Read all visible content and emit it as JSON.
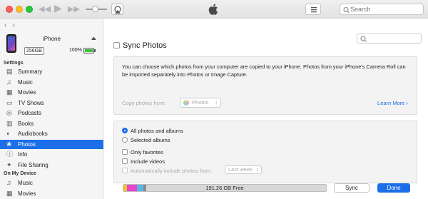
{
  "titlebar": {
    "search_placeholder": "Search"
  },
  "device": {
    "name": "iPhone",
    "capacity": "256GB",
    "battery": "100%",
    "battery_level": 1.0
  },
  "sidebar": {
    "settings_header": "Settings",
    "settings_items": [
      {
        "label": "Summary",
        "icon": "summary-icon"
      },
      {
        "label": "Music",
        "icon": "music-icon"
      },
      {
        "label": "Movies",
        "icon": "movies-icon"
      },
      {
        "label": "TV Shows",
        "icon": "tv-icon"
      },
      {
        "label": "Podcasts",
        "icon": "podcasts-icon"
      },
      {
        "label": "Books",
        "icon": "books-icon"
      },
      {
        "label": "Audiobooks",
        "icon": "audiobooks-icon"
      },
      {
        "label": "Photos",
        "icon": "photos-icon",
        "active": true
      },
      {
        "label": "Info",
        "icon": "info-icon"
      },
      {
        "label": "File Sharing",
        "icon": "file-sharing-icon"
      }
    ],
    "device_header": "On My Device",
    "device_items": [
      {
        "label": "Music",
        "icon": "music-icon"
      },
      {
        "label": "Movies",
        "icon": "movies-icon"
      }
    ]
  },
  "main": {
    "sync_title": "Sync Photos",
    "description": "You can choose which photos from your computer are copied to your iPhone. Photos from your iPhone's Camera Roll can be imported separately into Photos or Image Capture.",
    "copy_from_label": "Copy photos from:",
    "copy_from_value": "Photos",
    "learn_more": "Learn More",
    "options": {
      "all_photos": "All photos and albums",
      "selected_albums": "Selected albums",
      "only_favorites": "Only favorites",
      "include_videos": "Include videos",
      "auto_include": "Automatically include photos from:",
      "auto_include_value": "Last week"
    }
  },
  "footer": {
    "free_space": "191.26 GB Free",
    "sync_label": "Sync",
    "done_label": "Done"
  },
  "colors": {
    "accent": "#1c6fe8",
    "storage_segments": [
      "#f2c23a",
      "#e845c8",
      "#58b8e8",
      "#8c8c8c"
    ]
  }
}
